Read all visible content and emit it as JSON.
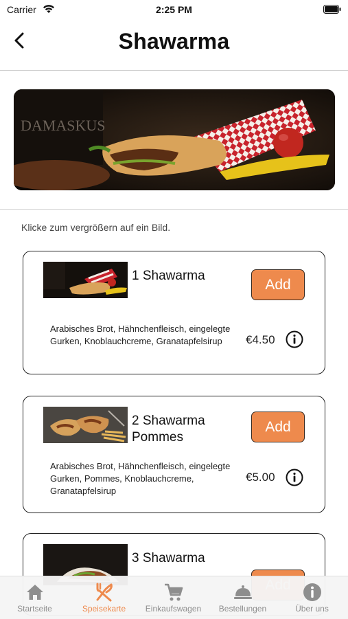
{
  "status_bar": {
    "carrier": "Carrier",
    "time": "2:25 PM"
  },
  "header": {
    "title": "Shawarma"
  },
  "hint": "Klicke zum vergrößern auf ein Bild.",
  "hero": {
    "logo_text": "DAMASKUS"
  },
  "menu_items": [
    {
      "name": "1 Shawarma",
      "add_label": "Add",
      "description": "Arabisches Brot, Hähnchenfleisch, eingelegte Gurken, Knoblauchcreme, Granatapfelsirup",
      "price": "€4.50"
    },
    {
      "name": "2 Shawarma Pommes",
      "add_label": "Add",
      "description": "Arabisches Brot, Hähnchenfleisch, eingelegte Gurken, Pommes, Knoblauchcreme, Granatapfelsirup",
      "price": "€5.00"
    },
    {
      "name": "3 Shawarma",
      "add_label": "Add"
    }
  ],
  "tab_bar": {
    "active_color": "#ee8a4d",
    "inactive_color": "#8e8e8e",
    "tabs": [
      {
        "label": "Startseite",
        "icon": "home-icon"
      },
      {
        "label": "Speisekarte",
        "icon": "fork-knife-icon",
        "active": true
      },
      {
        "label": "Einkaufswagen",
        "icon": "cart-icon"
      },
      {
        "label": "Bestellungen",
        "icon": "cloche-icon"
      },
      {
        "label": "Über uns",
        "icon": "info-icon"
      }
    ]
  }
}
